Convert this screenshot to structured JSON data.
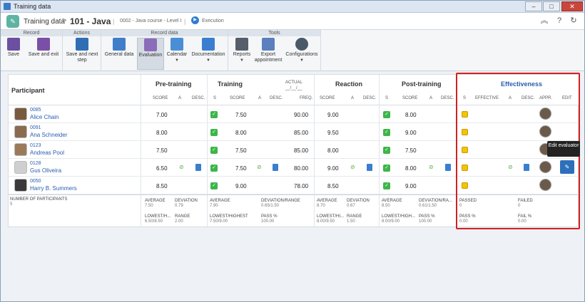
{
  "window": {
    "title": "Training data"
  },
  "header": {
    "app": "Training data",
    "separator": ">",
    "record": "101 - Java",
    "pipe": "|",
    "subtitle": "0002 - Java course - Level I",
    "status": "Execution"
  },
  "ribbon": {
    "groups": [
      {
        "label": "Record"
      },
      {
        "label": "Actions"
      },
      {
        "label": "Record data"
      },
      {
        "label": "Tools"
      }
    ],
    "buttons": {
      "save": "Save",
      "save_exit": "Save and exit",
      "save_next": "Save and next step",
      "general": "General data",
      "evaluation": "Evaluation",
      "calendar": "Calendar",
      "documentation": "Documentation",
      "reports": "Reports",
      "export": "Export appointment",
      "configurations": "Configurations"
    }
  },
  "table": {
    "participant_header": "Participant",
    "sections": {
      "pre": "Pre-training",
      "training": "Training",
      "reaction": "Reaction",
      "post": "Post-training",
      "effectiveness": "Effectiveness"
    },
    "sub": {
      "score": "SCORE",
      "a": "A",
      "desc": "DESC.",
      "s": "S",
      "freq": "FREQ.",
      "effective": "EFFECTIVE",
      "appr": "APPR.",
      "edit": "EDIT",
      "actual": "ACTUAL",
      "blank": "__/__/__"
    },
    "rows": [
      {
        "id": "0085",
        "name": "Alice Chain",
        "pre": "7.00",
        "train": "7.50",
        "freq": "90.00",
        "react": "9.00",
        "post": "8.00"
      },
      {
        "id": "0091",
        "name": "Ana Schneider",
        "pre": "8.00",
        "train": "8.00",
        "freq": "85.00",
        "react": "9.50",
        "post": "9.00"
      },
      {
        "id": "0123",
        "name": "Andreas Pool",
        "pre": "7.50",
        "train": "7.50",
        "freq": "85.00",
        "react": "8.00",
        "post": "7.50"
      },
      {
        "id": "0128",
        "name": "Gus Oliveira",
        "pre": "6.50",
        "train": "7.50",
        "freq": "80.00",
        "react": "9.00",
        "post": "8.00"
      },
      {
        "id": "0050",
        "name": "Harry B. Summers",
        "pre": "8.50",
        "train": "9.00",
        "freq": "78.00",
        "react": "8.50",
        "post": "9.00"
      }
    ],
    "footer": {
      "num_label": "NUMBER OF PARTICIPANTS",
      "num_value": "5",
      "pre": {
        "avg_l": "AVERAGE",
        "avg_v": "7.50",
        "dev_l": "DEVIATION",
        "dev_v": "0.79",
        "low_l": "LOWEST/H...",
        "low_v": "6.50/8.50",
        "range_l": "RANGE",
        "range_v": "2.00"
      },
      "train": {
        "avg_l": "AVERAGE",
        "avg_v": "7.90",
        "dev_l": "DEVIATION/RANGE",
        "dev_v": "0.65/1.50",
        "low_l": "LOWEST/HIGHEST",
        "low_v": "7.50/9.00",
        "pass_l": "PASS %",
        "pass_v": "100.00"
      },
      "react": {
        "avg_l": "AVERAGE",
        "avg_v": "8.70",
        "dev_l": "DEVIATION",
        "dev_v": "0.67",
        "low_l": "LOWEST/HI...",
        "low_v": "8.00/9.50",
        "range_l": "RANGE",
        "range_v": "1.50"
      },
      "post": {
        "avg_l": "AVERAGE",
        "avg_v": "8.50",
        "dev_l": "DEVIATION/RA...",
        "dev_v": "0.61/1.50",
        "low_l": "LOWEST/HIGH...",
        "low_v": "8.00/9.00",
        "pass_l": "PASS %",
        "pass_v": "100.00"
      },
      "eff": {
        "passed_l": "PASSED",
        "passed_v": "0",
        "failed_l": "FAILED",
        "failed_v": "0",
        "pass_l": "PASS %",
        "pass_v": "0.00",
        "fail_l": "FAIL %",
        "fail_v": "0.00"
      }
    }
  },
  "tooltip": {
    "text": "Edit evaluator"
  },
  "colors": {
    "accent": "#2f7fd0",
    "check": "#3db54a",
    "pending": "#f2c500",
    "highlight": "#d42020"
  }
}
